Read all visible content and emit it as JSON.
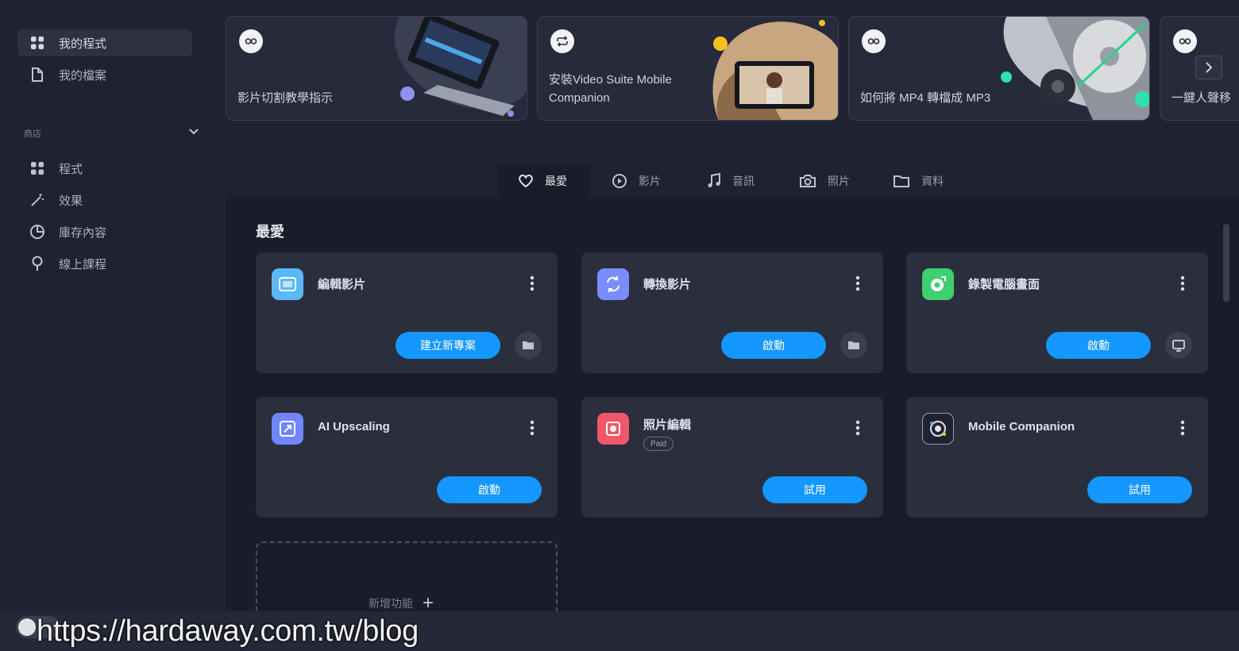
{
  "sidebar": {
    "items": [
      {
        "label": "我的程式",
        "icon": "grid-icon"
      },
      {
        "label": "我的檔案",
        "icon": "file-icon"
      }
    ],
    "section_label": "商店",
    "store_items": [
      {
        "label": "程式",
        "icon": "grid-icon"
      },
      {
        "label": "效果",
        "icon": "magic-wand-icon"
      },
      {
        "label": "庫存內容",
        "icon": "pie-chart-icon"
      },
      {
        "label": "線上課程",
        "icon": "lightbulb-icon"
      }
    ]
  },
  "banners": [
    {
      "title": "影片切割教學指示",
      "icon": "play-icon"
    },
    {
      "title_line1": "安裝Video Suite Mobile",
      "title_line2": "Companion",
      "icon": "repeat-icon"
    },
    {
      "title": "如何將 MP4 轉檔成 MP3",
      "icon": "play-icon"
    },
    {
      "title": "一鍵人聲移",
      "icon": "play-icon"
    }
  ],
  "tabs": [
    {
      "label": "最愛",
      "icon": "heart-icon"
    },
    {
      "label": "影片",
      "icon": "play-circle-icon"
    },
    {
      "label": "音訊",
      "icon": "music-note-icon"
    },
    {
      "label": "照片",
      "icon": "camera-icon"
    },
    {
      "label": "資料",
      "icon": "folder-icon"
    }
  ],
  "main": {
    "title": "最愛",
    "cards": [
      {
        "name": "編輯影片",
        "button": "建立新專案",
        "color": "#5ab8f5",
        "secondary_icon": "folder-icon"
      },
      {
        "name": "轉換影片",
        "button": "啟動",
        "color": "#7b8cff",
        "secondary_icon": "folder-icon"
      },
      {
        "name": "錄製電腦畫面",
        "button": "啟動",
        "color": "#3ecf6e",
        "secondary_icon": "monitor-icon"
      },
      {
        "name": "AI Upscaling",
        "button": "啟動",
        "color": "#6f86ff"
      },
      {
        "name": "照片編輯",
        "badge": "Paid",
        "button": "試用",
        "color": "#f2566a"
      },
      {
        "name": "Mobile Companion",
        "button": "試用",
        "color": "#1f2230"
      }
    ],
    "add_label": "新增功能"
  },
  "watermark": "https://hardaway.com.tw/blog",
  "colors": {
    "accent": "#1497ff",
    "background": "#1f2230",
    "panel": "#1a1d29",
    "card": "#2a2e3d"
  }
}
